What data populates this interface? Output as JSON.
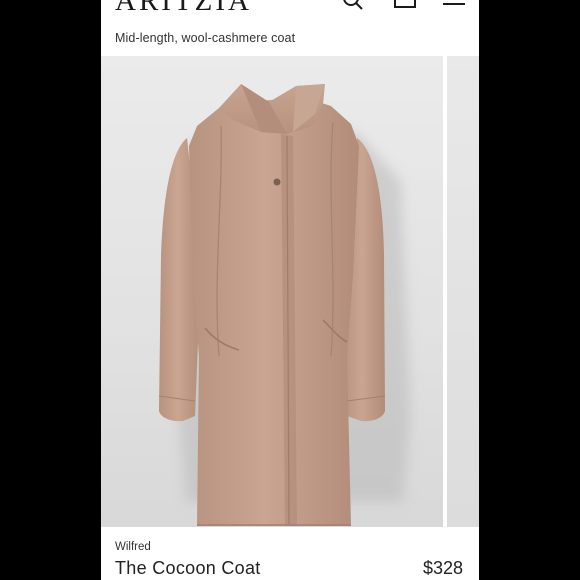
{
  "header": {
    "brand": "ARITZIA",
    "icons": [
      "search-icon",
      "shopping-bag-icon",
      "menu-icon"
    ]
  },
  "product": {
    "tagline": "Mid-length, wool-cashmere coat",
    "brand_name": "Wilfred",
    "name": "The Cocoon Coat",
    "price": "$328"
  },
  "colors": {
    "page_background": "#000000",
    "card_background": "#ffffff",
    "photo_background": "#e4e4e4",
    "coat_color": "#c4a08f",
    "text": "#222222"
  }
}
